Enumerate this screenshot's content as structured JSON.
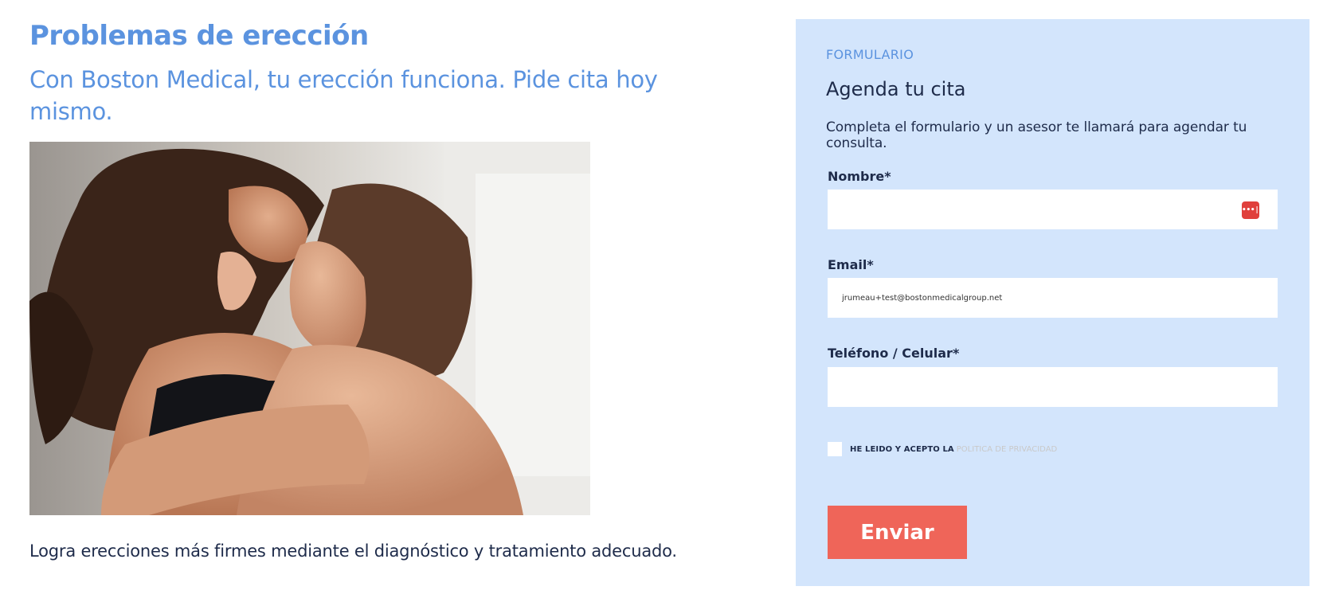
{
  "header": {
    "title": "Problemas de erección",
    "subtitle": "Con Boston Medical, tu erección funciona. Pide cita hoy mismo."
  },
  "main": {
    "description": "Logra erecciones más firmes mediante el diagnóstico y tratamiento adecuado."
  },
  "form": {
    "eyebrow": "FORMULARIO",
    "title": "Agenda tu cita",
    "description": "Completa el formulario y un asesor te llamará para agendar tu consulta.",
    "fields": {
      "name": {
        "label": "Nombre*",
        "value": ""
      },
      "email": {
        "label": "Email*",
        "value": "jrumeau+test@bostonmedicalgroup.net"
      },
      "phone": {
        "label": "Teléfono / Celular*",
        "value": ""
      }
    },
    "consent_text": "HE LEIDO Y ACEPTO LA",
    "consent_link": "POLITICA DE PRIVACIDAD",
    "submit_label": "Enviar"
  },
  "colors": {
    "accent": "#5b93df",
    "panel_bg": "#d3e5fc",
    "button": "#ef6559",
    "text": "#1e2b4a"
  }
}
